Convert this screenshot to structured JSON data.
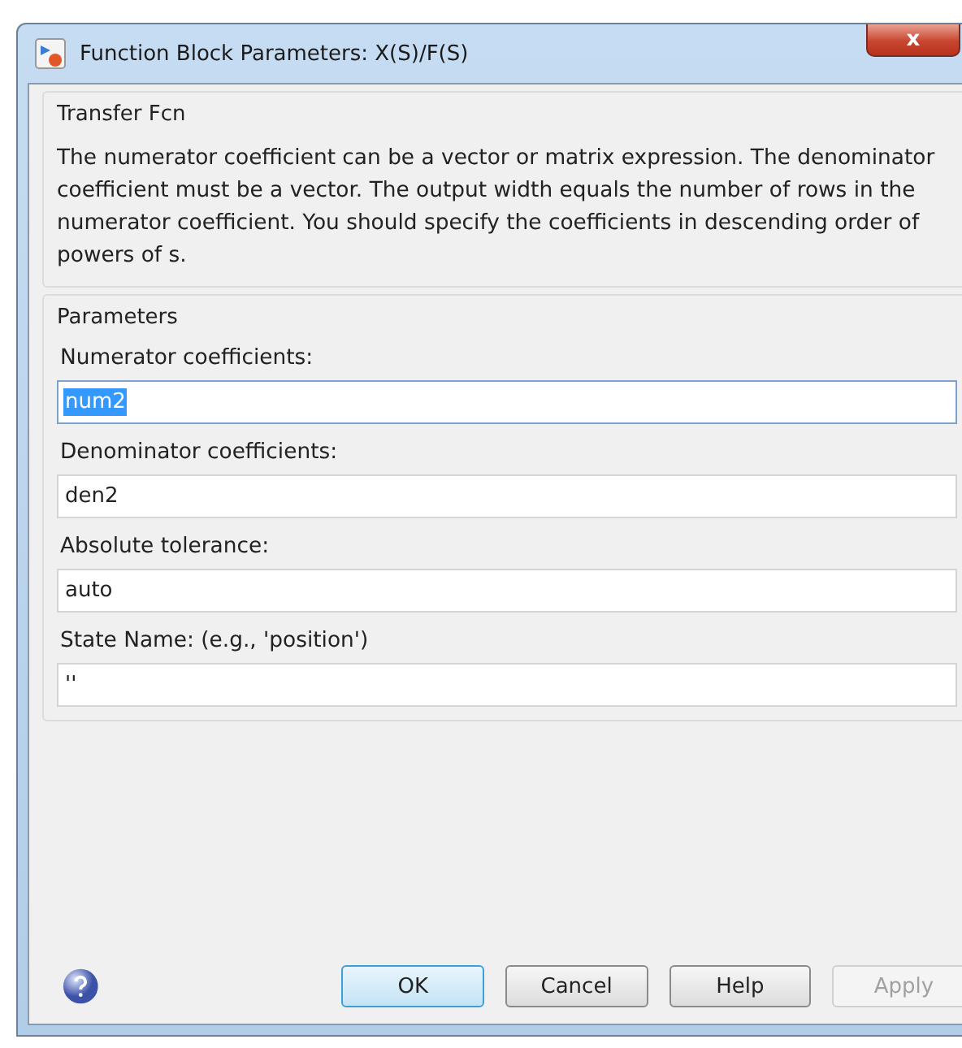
{
  "window": {
    "title": "Function Block Parameters: X(S)/F(S)",
    "close_symbol": "x"
  },
  "description_group": {
    "title": "Transfer Fcn",
    "text": "The numerator coefficient can be a vector or matrix expression. The denominator coefficient must be a vector. The output width equals the number of rows in the numerator coefficient. You should specify the coefficients in descending order of powers of s."
  },
  "parameters": {
    "title": "Parameters",
    "fields": [
      {
        "label": "Numerator coefficients:",
        "value": "num2",
        "text_selected": true
      },
      {
        "label": "Denominator coefficients:",
        "value": "den2",
        "text_selected": false
      },
      {
        "label": "Absolute tolerance:",
        "value": "auto",
        "text_selected": false
      },
      {
        "label": "State Name: (e.g., 'position')",
        "value": "''",
        "text_selected": false
      }
    ]
  },
  "buttons": [
    {
      "label": "OK",
      "default": true,
      "disabled": false
    },
    {
      "label": "Cancel",
      "default": false,
      "disabled": false
    },
    {
      "label": "Help",
      "default": false,
      "disabled": false
    },
    {
      "label": "Apply",
      "default": false,
      "disabled": true
    }
  ]
}
